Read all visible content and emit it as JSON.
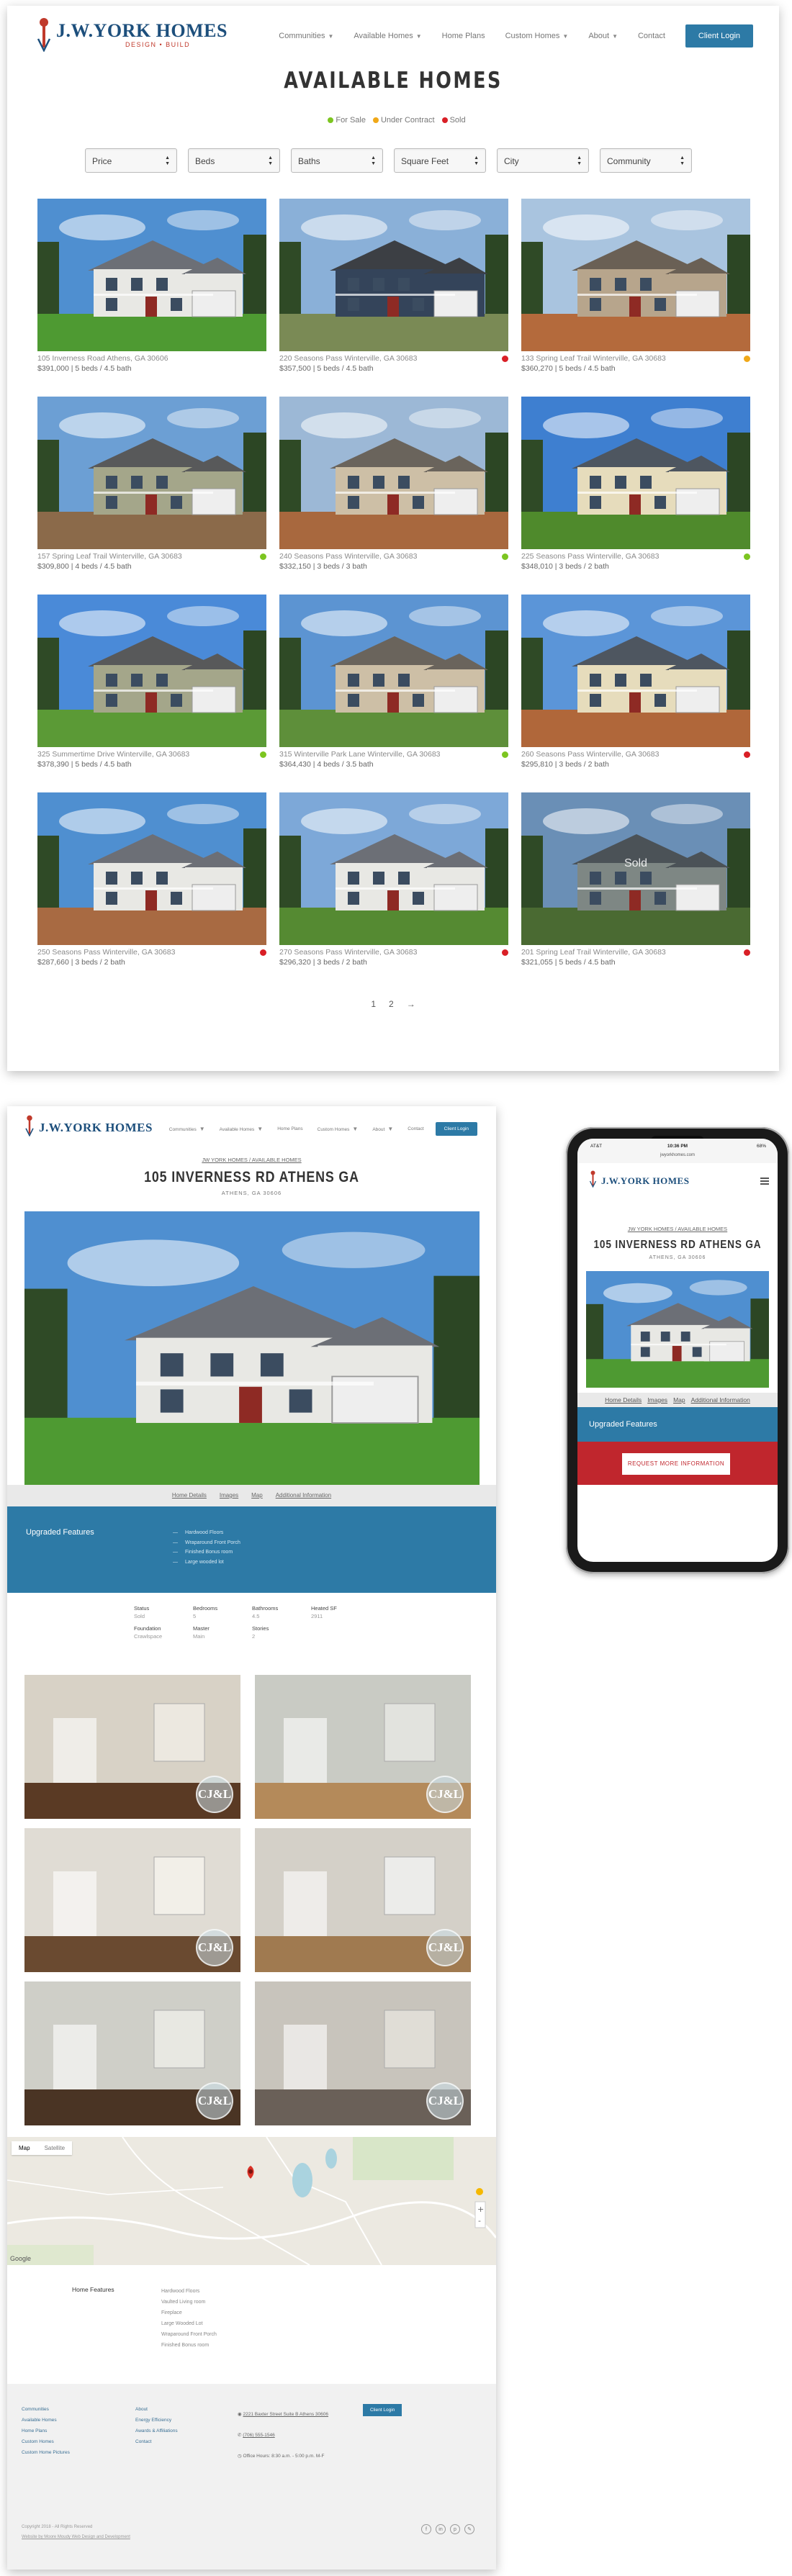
{
  "brand": {
    "name": "J.W.YORK HOMES",
    "tagline": "DESIGN • BUILD"
  },
  "nav": {
    "items": [
      {
        "label": "Communities",
        "dropdown": true
      },
      {
        "label": "Available Homes",
        "dropdown": true
      },
      {
        "label": "Home Plans",
        "dropdown": false
      },
      {
        "label": "Custom Homes",
        "dropdown": true
      },
      {
        "label": "About",
        "dropdown": true
      },
      {
        "label": "Contact",
        "dropdown": false
      }
    ],
    "login": "Client Login"
  },
  "listing": {
    "title": "AVAILABLE HOMES",
    "legend": [
      {
        "label": "For Sale",
        "color": "#7cc520"
      },
      {
        "label": "Under Contract",
        "color": "#f0a818"
      },
      {
        "label": "Sold",
        "color": "#d91f26"
      }
    ],
    "filters": [
      "Price",
      "Beds",
      "Baths",
      "Square Feet",
      "City",
      "Community"
    ],
    "homes": [
      {
        "address": "105 Inverness Road Athens, GA 30606",
        "facts": "$391,000 | 5 beds / 4.5 bath",
        "status": "none",
        "house": "white",
        "sky": "#4f8fd0",
        "ground": "#4e9a32"
      },
      {
        "address": "220 Seasons Pass Winterville, GA 30683",
        "facts": "$357,500 | 5 beds / 4.5 bath",
        "status": "sold",
        "house": "navy",
        "sky": "#8ab0d8",
        "ground": "#7a8a55"
      },
      {
        "address": "133 Spring Leaf Trail Winterville, GA 30683",
        "facts": "$360,270 | 5 beds / 4.5 bath",
        "status": "contract",
        "house": "tan",
        "sky": "#a9c4df",
        "ground": "#b46a3c"
      },
      {
        "address": "157 Spring Leaf Trail Winterville, GA 30683",
        "facts": "$309,800 | 4 beds / 4.5 bath",
        "status": "sale",
        "house": "sage",
        "sky": "#6c9fd4",
        "ground": "#8b6a4a"
      },
      {
        "address": "240 Seasons Pass Winterville, GA 30683",
        "facts": "$332,150 | 3 beds / 3 bath",
        "status": "sale",
        "house": "beige",
        "sky": "#9cb8d6",
        "ground": "#a8683e"
      },
      {
        "address": "225 Seasons Pass Winterville, GA 30683",
        "facts": "$348,010 | 3 beds / 2 bath",
        "status": "sale",
        "house": "cream",
        "sky": "#3e7fd0",
        "ground": "#4f8a2c"
      },
      {
        "address": "325 Summertime Drive Winterville, GA 30683",
        "facts": "$378,390 | 5 beds / 4.5 bath",
        "status": "sale",
        "house": "sage",
        "sky": "#4a8ad8",
        "ground": "#5b9a36"
      },
      {
        "address": "315 Winterville Park Lane Winterville, GA 30683",
        "facts": "$364,430 | 4 beds / 3.5 bath",
        "status": "sale",
        "house": "beige",
        "sky": "#5c94d2",
        "ground": "#5e8f3a"
      },
      {
        "address": "260 Seasons Pass Winterville, GA 30683",
        "facts": "$295,810 | 3 beds / 2 bath",
        "status": "sold",
        "house": "cream",
        "sky": "#5b95d8",
        "ground": "#b0673a"
      },
      {
        "address": "250 Seasons Pass Winterville, GA 30683",
        "facts": "$287,660 | 3 beds / 2 bath",
        "status": "sold",
        "house": "white",
        "sky": "#4f8fd0",
        "ground": "#a86a42"
      },
      {
        "address": "270 Seasons Pass Winterville, GA 30683",
        "facts": "$296,320 | 3 beds / 2 bath",
        "status": "sold",
        "house": "white",
        "sky": "#7da8d8",
        "ground": "#558a32"
      },
      {
        "address": "201 Spring Leaf Trail Winterville, GA 30683",
        "facts": "$321,055 | 5 beds / 4.5 bath",
        "status": "sold",
        "house": "gray",
        "sky": "#6a8fb6",
        "ground": "#4a6a32",
        "overlay": "Sold"
      }
    ],
    "pagination": [
      "1",
      "2",
      "→"
    ]
  },
  "detail": {
    "breadcrumb": "JW YORK HOMES / AVAILABLE HOMES",
    "title": "105 INVERNESS RD ATHENS GA",
    "subtitle": "ATHENS, GA 30606",
    "tabs": [
      "Home Details",
      "Images",
      "Map",
      "Additional Information"
    ],
    "upgraded_title": "Upgraded Features",
    "upgraded": [
      "Hardwood Floors",
      "Wraparound Front Porch",
      "Finished Bonus room",
      "Large wooded lot"
    ],
    "specs": [
      {
        "k": "Status",
        "v": "Sold"
      },
      {
        "k": "Bedrooms",
        "v": "5"
      },
      {
        "k": "Bathrooms",
        "v": "4.5"
      },
      {
        "k": "Heated SF",
        "v": "2911"
      },
      {
        "k": "Foundation",
        "v": "Crawlspace"
      },
      {
        "k": "Master",
        "v": "Main"
      },
      {
        "k": "Stories",
        "v": "2"
      }
    ],
    "gallery_badge": "CJ&L",
    "map": {
      "tab_map": "Map",
      "tab_sat": "Satellite",
      "credit": "Google"
    },
    "home_features_title": "Home Features",
    "home_features": [
      "Hardwood Floors",
      "Vaulted Living room",
      "Fireplace",
      "Large Wooded Lot",
      "Wraparound Front Porch",
      "Finished Bonus room"
    ],
    "footer": {
      "col1": [
        "Communities",
        "Available Homes",
        "Home Plans",
        "Custom Homes",
        "Custom Home Pictures"
      ],
      "col2": [
        "About",
        "Energy Efficiency",
        "Awards & Affiliations",
        "Contact"
      ],
      "address": "2221 Baxter Street Suite B Athens 30606",
      "phone": "(706) 555-1546",
      "hours": "Office Hours: 8:30 a.m. - 5:00 p.m. M-F",
      "login": "Client Login",
      "copyright": "Copyright 2018 - All Rights Reserved",
      "credit": "Website by Moore Moudy Web Design and Development",
      "social": [
        "f",
        "in",
        "p",
        "✎"
      ]
    }
  },
  "mobile": {
    "carrier": "AT&T",
    "time": "10:36 PM",
    "battery": "68%",
    "url": "jwyorkhomes.com",
    "breadcrumb": "JW YORK HOMES / AVAILABLE HOMES",
    "title": "105 INVERNESS RD ATHENS GA",
    "subtitle": "ATHENS, GA 30606",
    "tabs": [
      "Home Details",
      "Images",
      "Map",
      "Additional Information"
    ],
    "upgraded_title": "Upgraded Features",
    "request_button": "REQUEST MORE INFORMATION"
  }
}
